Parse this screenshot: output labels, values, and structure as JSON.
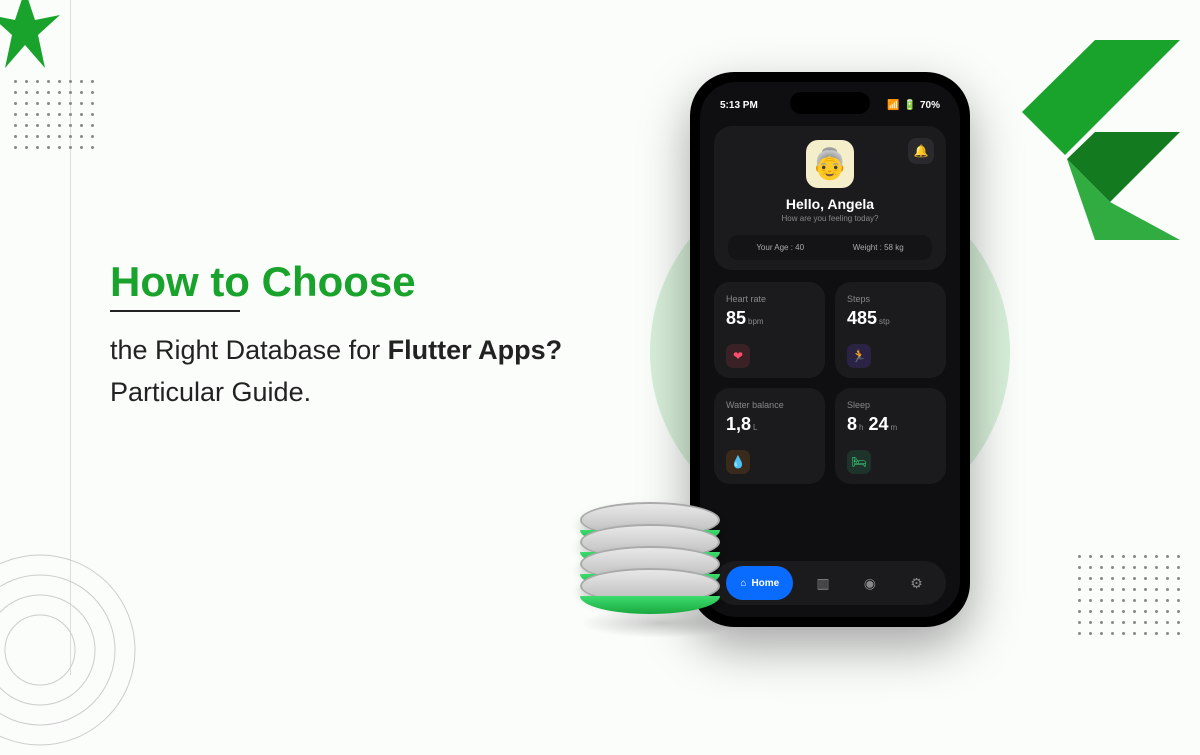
{
  "headline": {
    "top": "How to Choose",
    "line1_pre": "the Right Database for ",
    "line1_bold": "Flutter Apps?",
    "line2": "Particular Guide."
  },
  "phone": {
    "status": {
      "time": "5:13 PM",
      "battery": "70%"
    },
    "user": {
      "greeting": "Hello, Angela",
      "subtitle": "How are you feeling today?",
      "age_label": "Your Age : 40",
      "weight_label": "Weight : 58 kg",
      "avatar_emoji": "👵"
    },
    "stats": {
      "heart": {
        "label": "Heart rate",
        "value": "85",
        "unit": "bpm"
      },
      "steps": {
        "label": "Steps",
        "value": "485",
        "unit": "stp"
      },
      "water": {
        "label": "Water balance",
        "value": "1,8",
        "unit": "L"
      },
      "sleep": {
        "label": "Sleep",
        "value_h": "8",
        "unit_h": "h",
        "value_m": "24",
        "unit_m": "m"
      }
    },
    "nav": {
      "home": "Home"
    }
  },
  "icons": {
    "bell": "bell-icon",
    "heart": "❤",
    "run": "🏃",
    "drop": "💧",
    "bed": "🛏",
    "home": "⌂",
    "chart": "▥",
    "user": "◉",
    "gear": "⚙",
    "signal": "▮▮▮",
    "batt": "▭"
  }
}
